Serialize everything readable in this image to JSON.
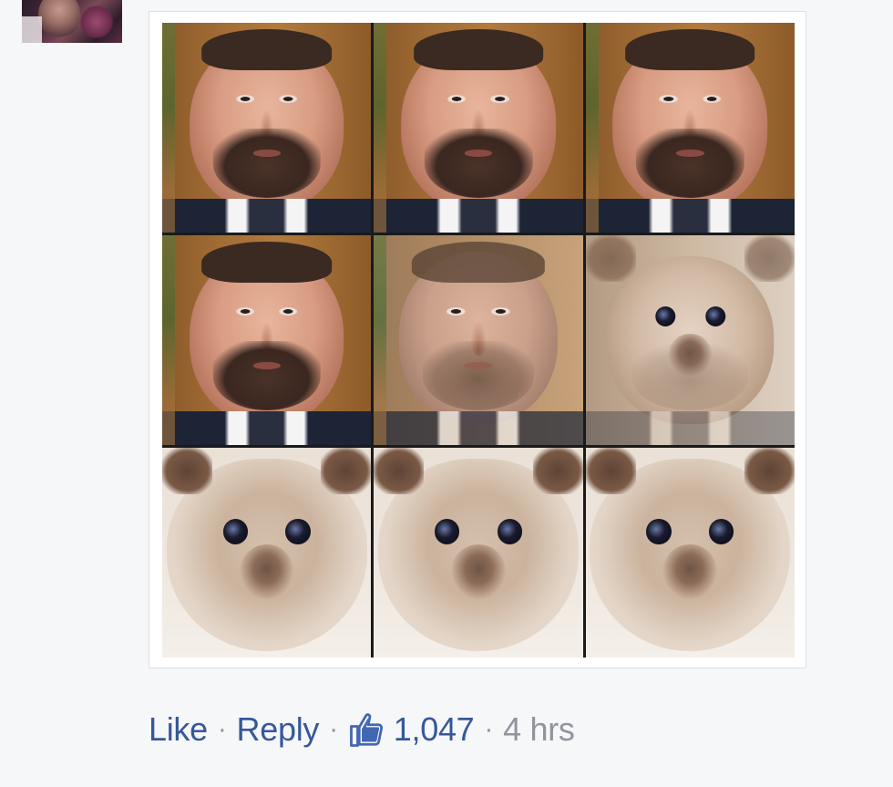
{
  "comment": {
    "avatar_icon": "user-avatar",
    "image": {
      "description_icon": "face-morph-grid",
      "rows": 3,
      "cols": 3
    },
    "actions": {
      "like_label": "Like",
      "reply_label": "Reply",
      "separator": "·",
      "reaction_icon": "thumbs-up-icon",
      "reaction_count": "1,047",
      "timestamp": "4 hrs"
    },
    "colors": {
      "link": "#365899",
      "meta": "#90949c",
      "background": "#f6f7f9",
      "reaction_blue": "#4267b2"
    }
  }
}
